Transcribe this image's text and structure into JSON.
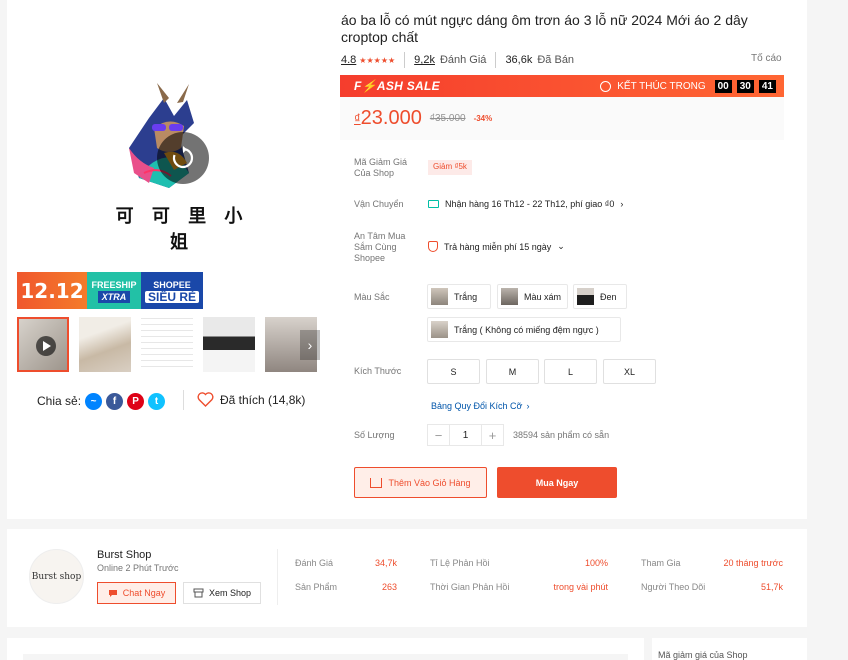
{
  "product": {
    "title": "áo ba lỗ có mút ngực dáng ôm trơn áo 3 lỗ nữ 2024 Mới áo 2 dây croptop chất",
    "brand_text": "可 可 里 小 姐",
    "rating": "4.8",
    "stars": "★★★★★",
    "reviews_count": "9,2k",
    "reviews_label": "Đánh Giá",
    "sold_count": "36,6k",
    "sold_label": "Đã Bán",
    "report_label": "Tố cáo"
  },
  "promo": {
    "badge_1212": "12.12",
    "freeship": "FREESHIP",
    "xtra": "XTRA",
    "shopee": "SHOPEE",
    "sieu_re": "SIÊU RẺ"
  },
  "flash_sale": {
    "title": "F⚡ASH SALE",
    "ends_label": "KẾT THÚC TRONG",
    "hours": "00",
    "minutes": "30",
    "seconds": "41"
  },
  "price": {
    "currency": "₫",
    "current": "23.000",
    "original": "₫35.000",
    "discount": "-34%"
  },
  "details": {
    "voucher_label": "Mã Giảm Giá Của Shop",
    "voucher_chip": "Giảm ₫5k",
    "shipping_label": "Vận Chuyển",
    "shipping_text": "Nhận hàng 16 Th12 - 22 Th12, phí giao ₫0",
    "safe_label": "An Tâm Mua Sắm Cùng Shopee",
    "safe_text": "Trả hàng miễn phí 15 ngày",
    "color_label": "Màu Sắc",
    "colors": [
      "Trắng",
      "Màu xám",
      "Đen",
      "Trắng ( Không có miếng đệm ngực )"
    ],
    "size_label": "Kích Thước",
    "sizes": [
      "S",
      "M",
      "L",
      "XL"
    ],
    "size_guide": "Bảng Quy Đổi Kích Cỡ",
    "qty_label": "Số Lượng",
    "qty_value": "1",
    "stock_text": "38594 sản phẩm có sẵn",
    "add_to_cart": "Thêm Vào Giỏ Hàng",
    "buy_now": "Mua Ngay"
  },
  "share": {
    "label": "Chia sẻ:",
    "liked": "Đã thích (14,8k)"
  },
  "shop": {
    "name": "Burst Shop",
    "status": "Online 2 Phút Trước",
    "avatar_text": "Burst shop",
    "chat_button": "Chat Ngay",
    "view_button": "Xem Shop",
    "stats": {
      "ratings_label": "Đánh Giá",
      "ratings_value": "34,7k",
      "products_label": "Sản Phẩm",
      "products_value": "263",
      "response_rate_label": "Tỉ Lệ Phản Hồi",
      "response_rate_value": "100%",
      "response_time_label": "Thời Gian Phản Hồi",
      "response_time_value": "trong vài phút",
      "joined_label": "Tham Gia",
      "joined_value": "20 tháng trước",
      "followers_label": "Người Theo Dõi",
      "followers_value": "51,7k"
    }
  },
  "sidebar": {
    "voucher_title": "Mã giảm giá của Shop"
  },
  "colors": {
    "accent": "#ee4d2d",
    "link": "#0055aa",
    "ship_green": "#00bfa5"
  }
}
